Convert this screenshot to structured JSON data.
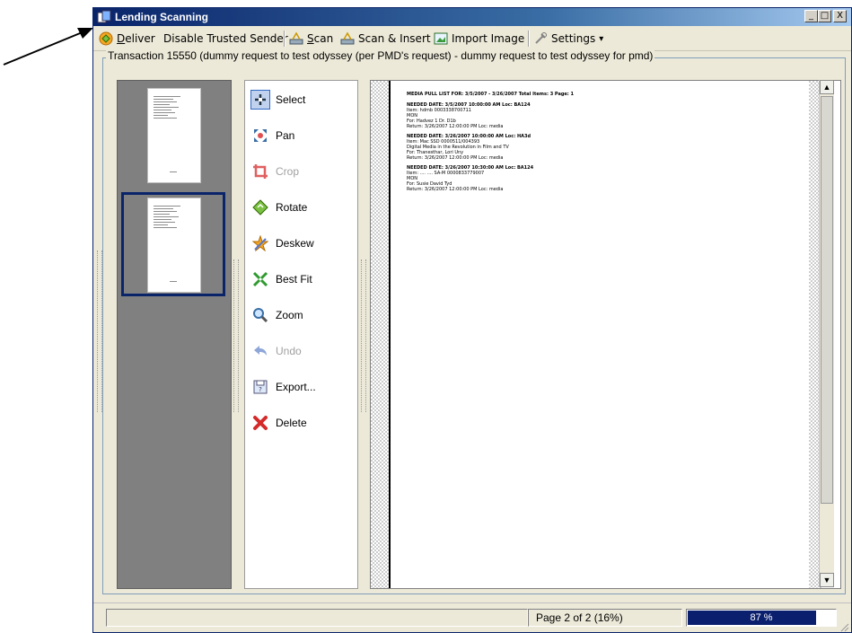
{
  "window": {
    "title": "Lending Scanning",
    "minimize": "_",
    "maximize": "□",
    "close": "X"
  },
  "toolbar": {
    "deliver_label": "Deliver",
    "deliver_accel": "D",
    "deliver_rest": "eliver",
    "disable_trusted": "Disable Trusted Sender",
    "scan_accel": "S",
    "scan_rest": "can",
    "scan_insert": "Scan & Insert",
    "import_image": "Import Image",
    "settings": "Settings",
    "settings_arrow": "▾"
  },
  "transaction": {
    "legend": "Transaction 15550  (dummy request to test odyssey (per PMD's request) - dummy request to test odyssey for pmd)"
  },
  "thumbnails": {
    "count": 2,
    "selected_index": 2
  },
  "tools": [
    {
      "label": "Select",
      "icon": "select-icon",
      "enabled": true,
      "selected": true
    },
    {
      "label": "Pan",
      "icon": "pan-icon",
      "enabled": true
    },
    {
      "label": "Crop",
      "icon": "crop-icon",
      "enabled": false
    },
    {
      "label": "Rotate",
      "icon": "rotate-icon",
      "enabled": true
    },
    {
      "label": "Deskew",
      "icon": "deskew-icon",
      "enabled": true
    },
    {
      "label": "Best Fit",
      "icon": "best-fit-icon",
      "enabled": true
    },
    {
      "label": "Zoom",
      "icon": "zoom-icon",
      "enabled": true
    },
    {
      "label": "Undo",
      "icon": "undo-icon",
      "enabled": false
    },
    {
      "label": "Export...",
      "icon": "export-icon",
      "enabled": true
    },
    {
      "label": "Delete",
      "icon": "delete-icon",
      "enabled": true
    }
  ],
  "document": {
    "header": "MEDIA PULL LIST FOR: 3/5/2007 - 3/26/2007     Total Items: 3     Page: 1",
    "blocks": [
      [
        "NEEDED DATE: 3/5/2007 10:00:00 AM  Loc: BA124",
        "Item: hdmb                     0003338700711",
        "   MON",
        "   For: Hadvez 1 Dr. D1b",
        "Return: 3/26/2007 12:00:00 PM  Loc: media"
      ],
      [
        "NEEDED DATE: 3/26/2007 10:00:00 AM  Loc: HA3d",
        "   Item: Mac          SSD              0000511/004393",
        "   Digital Media in the Revolution in Film and TV",
        "   For: Thanesthar, Lori Uny",
        "Return: 3/26/2007 12:00:00 PM  Loc: media"
      ],
      [
        "NEEDED DATE: 3/26/2007 10:30:00 AM  Loc: BA124",
        "   Item: .... ....     SA-M          0000833779007",
        "     MON",
        "   For: Susie David Tyd",
        "Return: 3/26/2007 12:00:00 PM  Loc: media"
      ]
    ]
  },
  "scrollbar": {
    "up": "▲",
    "down": "▼"
  },
  "status": {
    "page": "Page 2 of 2 (16%)",
    "progress_text": "87 %",
    "progress_value": 0.87
  },
  "colors": {
    "title_bar": "#0a246a",
    "progress_fill": "#0a1f6e",
    "selection_border": "#0a246a"
  }
}
